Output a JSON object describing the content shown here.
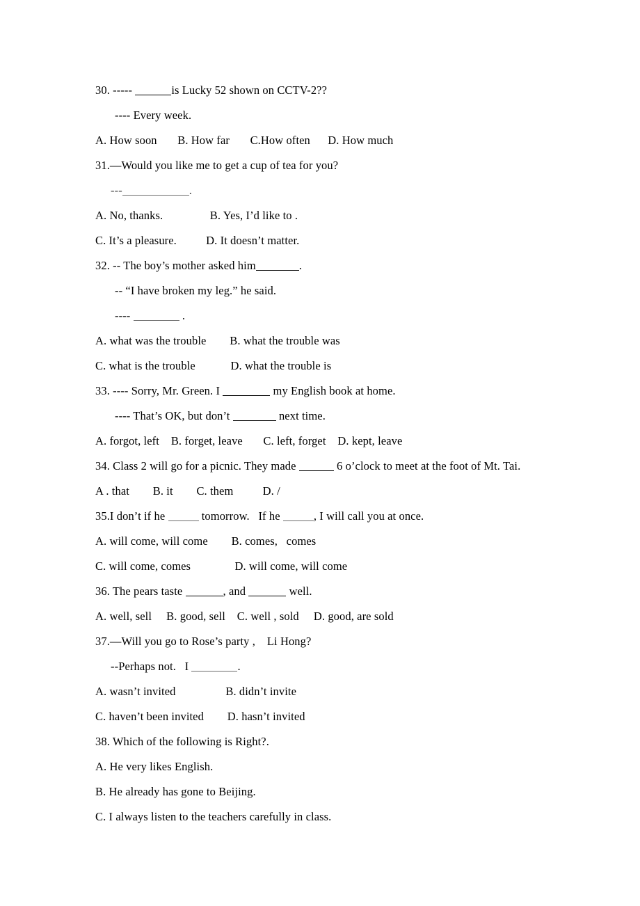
{
  "document": {
    "background_color": "#ffffff",
    "text_color": "#000000",
    "questions": [
      {
        "number": "30",
        "stem_lines": [
          {
            "pre": "30. ----- ",
            "blank_width": 52,
            "post": "is Lucky 52 shown on CCTV-2??"
          },
          {
            "pre": "---- Every week.",
            "blank_width": 0,
            "post": ""
          }
        ],
        "option_lines": [
          "A. How soon       B. How far       C.How often      D. How much"
        ]
      },
      {
        "number": "31",
        "stem_lines": [
          {
            "pre": "31.—Would you like me to get a cup of tea for you?",
            "blank_width": 0,
            "post": ""
          },
          {
            "pre": "---",
            "blank_width": 96,
            "post": "."
          }
        ],
        "option_lines": [
          "A. No, thanks.                B. Yes, I’d like to .",
          "C. It’s a pleasure.          D. It doesn’t matter."
        ]
      },
      {
        "number": "32",
        "stem_lines": [
          {
            "pre": "32. -- The boy’s mother asked him",
            "blank_width": 62,
            "post": "."
          },
          {
            "pre": "-- “I have broken my leg.” he said.",
            "blank_width": 0,
            "post": ""
          },
          {
            "pre": "---- ",
            "blank_width": 66,
            "post": " ."
          }
        ],
        "option_lines": [
          "A. what was the trouble        B. what the trouble was",
          "C. what is the trouble            D. what the trouble is"
        ]
      },
      {
        "number": "33",
        "stem_lines": [
          {
            "pre": "33. ---- Sorry, Mr. Green. I ",
            "blank_width": 68,
            "post": " my English book at home."
          },
          {
            "pre": "---- That’s OK, but don’t ",
            "blank_width": 62,
            "post": " next time."
          }
        ],
        "option_lines": [
          "A. forgot, left    B. forget, leave       C. left, forget    D. kept, leave"
        ]
      },
      {
        "number": "34",
        "stem_lines": [
          {
            "pre": "34. Class 2 will go for a picnic. They made ",
            "blank_width": 50,
            "post": " 6 o’clock to meet at the foot of Mt. Tai."
          }
        ],
        "option_lines": [
          "A . that        B. it        C. them          D. /"
        ]
      },
      {
        "number": "35",
        "stem_lines": [
          {
            "pre": "35.I don’t if he ",
            "blank_width": 44,
            "post": " tomorrow.   If he ",
            "blank2_width": 44,
            "post2": ", I will call you at once."
          }
        ],
        "option_lines": [
          "A. will come, will come        B. comes,   comes",
          "C. will come, comes               D. will come, will come"
        ]
      },
      {
        "number": "36",
        "stem_lines": [
          {
            "pre": "36. The pears taste ",
            "blank_width": 54,
            "post": ", and ",
            "blank2_width": 54,
            "post2": " well."
          }
        ],
        "option_lines": [
          "A. well, sell     B. good, sell    C. well , sold     D. good, are sold"
        ]
      },
      {
        "number": "37",
        "stem_lines": [
          {
            "pre": "37.—Will you go to Rose’s party ,    Li Hong?",
            "blank_width": 0,
            "post": ""
          },
          {
            "pre": "--Perhaps not.   I ",
            "blank_width": 66,
            "post": "."
          }
        ],
        "option_lines": [
          "A. wasn’t invited                 B. didn’t invite",
          "C. haven’t been invited        D. hasn’t invited"
        ]
      },
      {
        "number": "38",
        "stem_lines": [
          {
            "pre": "38. Which of the following is Right?.",
            "blank_width": 0,
            "post": ""
          }
        ],
        "option_lines": [
          "A. He very likes English.",
          "B. He already has gone to Beijing.",
          "C. I always listen to the teachers carefully in class."
        ]
      }
    ]
  },
  "lines": {
    "q30_l1_pre": "30. ----- ",
    "q30_l1_post": "is Lucky 52 shown on CCTV-2??",
    "q30_l2": "---- Every week.",
    "q30_opts": "A. How soon       B. How far       C.How often      D. How much",
    "q31_l1": "31.—Would you like me to get a cup of tea for you?",
    "q31_l2_pre": "---",
    "q31_l2_post": ".",
    "q31_optsAB": "A. No, thanks.                B. Yes, I’d like to .",
    "q31_optsCD": "C. It’s a pleasure.          D. It doesn’t matter.",
    "q32_l1_pre": "32. -- The boy’s mother asked him",
    "q32_l1_post": ".",
    "q32_l2": "-- “I have broken my leg.” he said.",
    "q32_l3_pre": "---- ",
    "q32_l3_post": " .",
    "q32_optsAB": "A. what was the trouble        B. what the trouble was",
    "q32_optsCD": "C. what is the trouble            D. what the trouble is",
    "q33_l1_pre": "33. ---- Sorry, Mr. Green. I ",
    "q33_l1_post": " my English book at home.",
    "q33_l2_pre": "---- That’s OK, but don’t ",
    "q33_l2_post": " next time.",
    "q33_opts": "A. forgot, left    B. forget, leave       C. left, forget    D. kept, leave",
    "q34_l1_pre": "34. Class 2 will go for a picnic. They made ",
    "q34_l1_post": " 6 o’clock to meet at the foot of Mt. Tai.",
    "q34_opts": "A . that        B. it        C. them          D. /",
    "q35_l1_pre": "35.I don’t if he ",
    "q35_l1_mid": " tomorrow.   If he ",
    "q35_l1_post": ", I will call you at once.",
    "q35_optsAB": "A. will come, will come        B. comes,   comes",
    "q35_optsCD": "C. will come, comes               D. will come, will come",
    "q36_l1_pre": "36. The pears taste ",
    "q36_l1_mid": ", and ",
    "q36_l1_post": " well.",
    "q36_opts": "A. well, sell     B. good, sell    C. well , sold     D. good, are sold",
    "q37_l1": "37.—Will you go to Rose’s party ,    Li Hong?",
    "q37_l2_pre": "--Perhaps not.   I ",
    "q37_l2_post": ".",
    "q37_optsAB": "A. wasn’t invited                 B. didn’t invite",
    "q37_optsCD": "C. haven’t been invited        D. hasn’t invited",
    "q38_l1": "38. Which of the following is Right?.",
    "q38_optA": "A. He very likes English.",
    "q38_optB": "B. He already has gone to Beijing.",
    "q38_optC": "C. I always listen to the teachers carefully in class."
  }
}
